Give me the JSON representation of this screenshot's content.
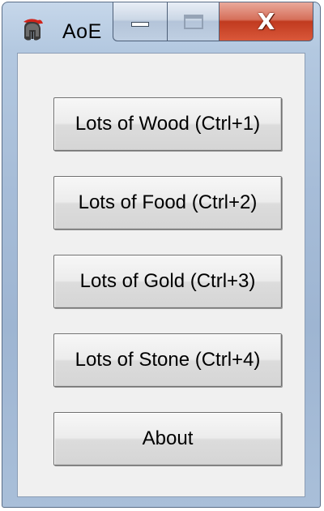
{
  "window": {
    "title": "AoE"
  },
  "caption_buttons": {
    "minimize_icon": "minimize-icon",
    "maximize_icon": "maximize-icon",
    "close_icon": "close-icon",
    "close_glyph": "X"
  },
  "buttons": [
    {
      "label": "Lots of Wood (Ctrl+1)"
    },
    {
      "label": "Lots of Food (Ctrl+2)"
    },
    {
      "label": "Lots of Gold (Ctrl+3)"
    },
    {
      "label": "Lots of Stone (Ctrl+4)"
    },
    {
      "label": "About"
    }
  ],
  "colors": {
    "close_button": "#c13a1f",
    "client_background": "#f0f0f0",
    "frame": "#a7bdd8"
  }
}
